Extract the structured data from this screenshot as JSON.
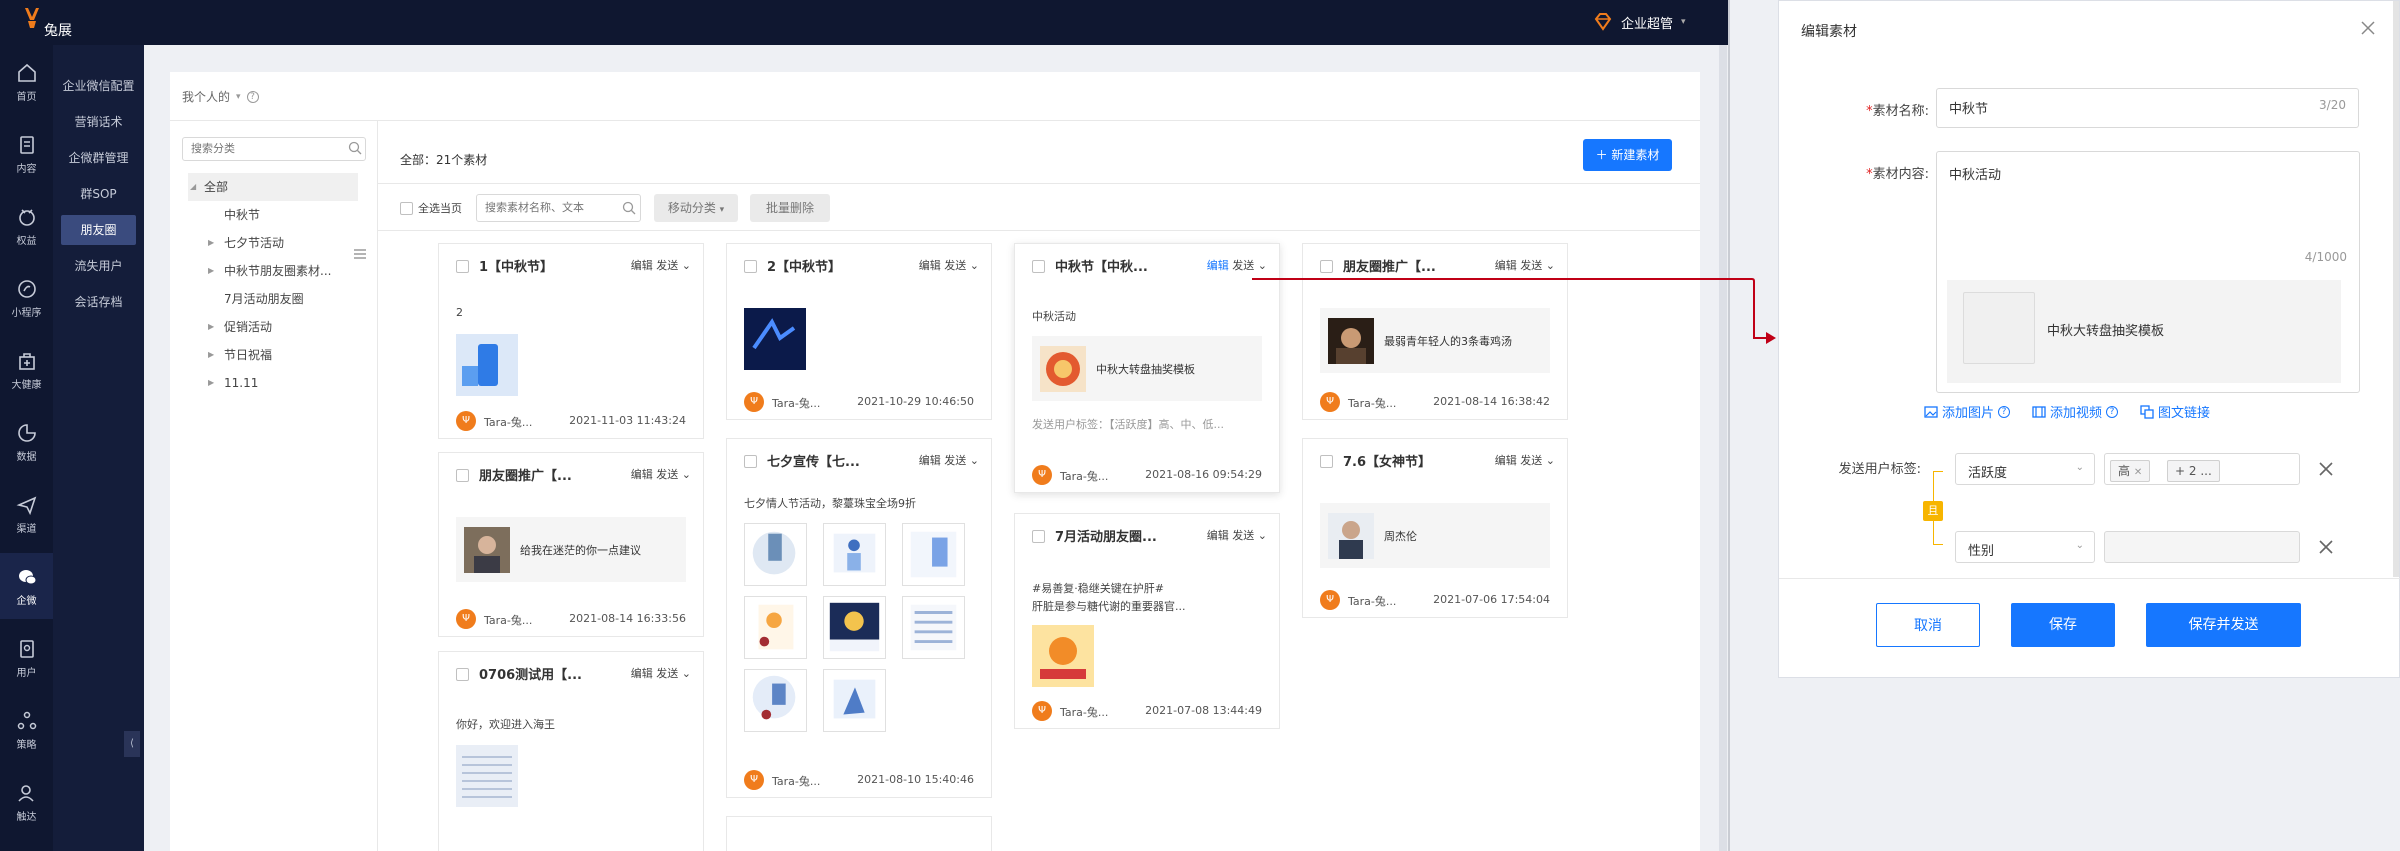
{
  "topbar": {
    "logo_text": "兔展",
    "org": "企业超管"
  },
  "nav": [
    {
      "label": "首页",
      "icon": "home-icon"
    },
    {
      "label": "内容",
      "icon": "document-icon"
    },
    {
      "label": "权益",
      "icon": "gift-icon"
    },
    {
      "label": "小程序",
      "icon": "miniprogram-icon"
    },
    {
      "label": "大健康",
      "icon": "health-icon"
    },
    {
      "label": "数据",
      "icon": "chart-icon"
    },
    {
      "label": "渠道",
      "icon": "send-icon"
    },
    {
      "label": "企微",
      "icon": "chat-icon"
    },
    {
      "label": "用户",
      "icon": "user-doc-icon"
    },
    {
      "label": "策略",
      "icon": "strategy-icon"
    },
    {
      "label": "触达",
      "icon": "reach-icon"
    }
  ],
  "subnav": [
    "企业微信配置",
    "营销话术",
    "企微群管理",
    "群SOP",
    "朋友圈",
    "流失用户",
    "会话存档"
  ],
  "breadcrumb": {
    "label": "我个人的"
  },
  "category": {
    "search_placeholder": "搜索分类",
    "items": [
      "全部",
      "中秋节",
      "七夕节活动",
      "中秋节朋友圈素材...",
      "7月活动朋友圈",
      "促销活动",
      "节日祝福",
      "11.11"
    ]
  },
  "main": {
    "total": "全部：21个素材",
    "new_button": "新建素材",
    "select_all": "全选当页",
    "search_placeholder": "搜索素材名称、文本",
    "move_button": "移动分类",
    "batch_delete": "批量删除"
  },
  "card_common": {
    "edit": "编辑",
    "send": "发送",
    "author": "Tara-兔..."
  },
  "cards": [
    {
      "title": "1【中秋节】",
      "text": "2",
      "time": "2021-11-03 11:43:24"
    },
    {
      "title": "朋友圈推广【...",
      "link": "给我在迷茫的你一点建议",
      "time": "2021-08-14 16:33:56"
    },
    {
      "title": "0706测试用【...",
      "text": "你好，欢迎进入海王"
    },
    {
      "title": "2【中秋节】",
      "time": "2021-10-29 10:46:50"
    },
    {
      "title": "七夕宣传【七...",
      "text": "七夕情人节活动，黎薹珠宝全场9折",
      "time": "2021-08-10 15:40:46"
    },
    {
      "title": "中秋节【中秋...",
      "text": "中秋活动",
      "link": "中秋大转盘抽奖模板",
      "tags": "发送用户标签：【活跃度】高、中、低...",
      "time": "2021-08-16 09:54:29"
    },
    {
      "title": "7月活动朋友圈...",
      "text": "#易善复·稳继关键在护肝#",
      "text2": "肝脏是参与糖代谢的重要器官...",
      "time": "2021-07-08 13:44:49"
    },
    {
      "title": "朋友圈推广【...",
      "link": "最弱青年轻人的3条毒鸡汤",
      "time": "2021-08-14 16:38:42"
    },
    {
      "title": "7.6【女神节】",
      "link": "周杰伦",
      "time": "2021-07-06 17:54:04"
    }
  ],
  "drawer": {
    "title": "编辑素材",
    "name_label": "素材名称:",
    "name_value": "中秋节",
    "name_count": "3/20",
    "content_label": "素材内容:",
    "content_value": "中秋活动",
    "content_count": "4/1000",
    "template": "中秋大转盘抽奖模板",
    "add_image": "添加图片",
    "add_video": "添加视频",
    "add_link": "图文链接",
    "tags_label": "发送用户标签:",
    "and_label": "且",
    "cond1": {
      "field": "活跃度",
      "tag": "高",
      "more": "+ 2 ..."
    },
    "cond2": {
      "field": "性别"
    },
    "cancel": "取消",
    "save": "保存",
    "save_send": "保存并发送"
  },
  "colors": {
    "primary": "#1677ff",
    "nav_bg": "#0f1730",
    "avatar": "#f07c1c",
    "and_tag": "#f7b500",
    "arrow": "#c00016"
  }
}
